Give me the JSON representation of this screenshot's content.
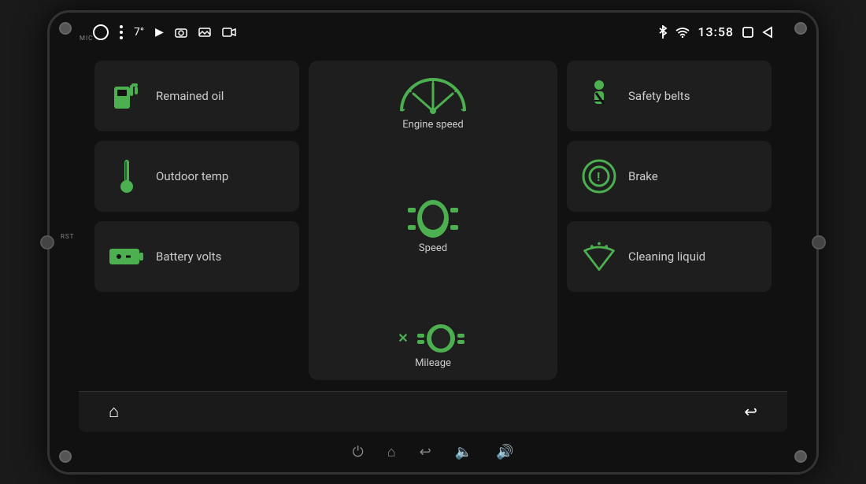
{
  "device": {
    "mic_label": "MIC",
    "rst_label": "RST"
  },
  "status_bar": {
    "temp": "7°",
    "time": "13:58",
    "bluetooth_icon": "bluetooth",
    "wifi_icon": "wifi"
  },
  "tiles": {
    "remained_oil": {
      "label": "Remained oil",
      "icon": "fuel-icon"
    },
    "outdoor_temp": {
      "label": "Outdoor temp",
      "icon": "thermometer-icon"
    },
    "battery_volts": {
      "label": "Battery volts",
      "icon": "battery-icon"
    },
    "safety_belts": {
      "label": "Safety belts",
      "icon": "seatbelt-icon"
    },
    "brake": {
      "label": "Brake",
      "icon": "brake-icon"
    },
    "cleaning_liquid": {
      "label": "Cleaning liquid",
      "icon": "wiper-icon"
    }
  },
  "center": {
    "engine_speed_label": "Engine speed",
    "speed_label": "Speed",
    "mileage_label": "Mileage"
  },
  "nav": {
    "home_label": "Home",
    "back_label": "Back"
  },
  "bottom_buttons": {
    "power": "⏻",
    "home": "⌂",
    "back": "↩",
    "vol_down": "🔈",
    "vol_up": "🔊"
  }
}
